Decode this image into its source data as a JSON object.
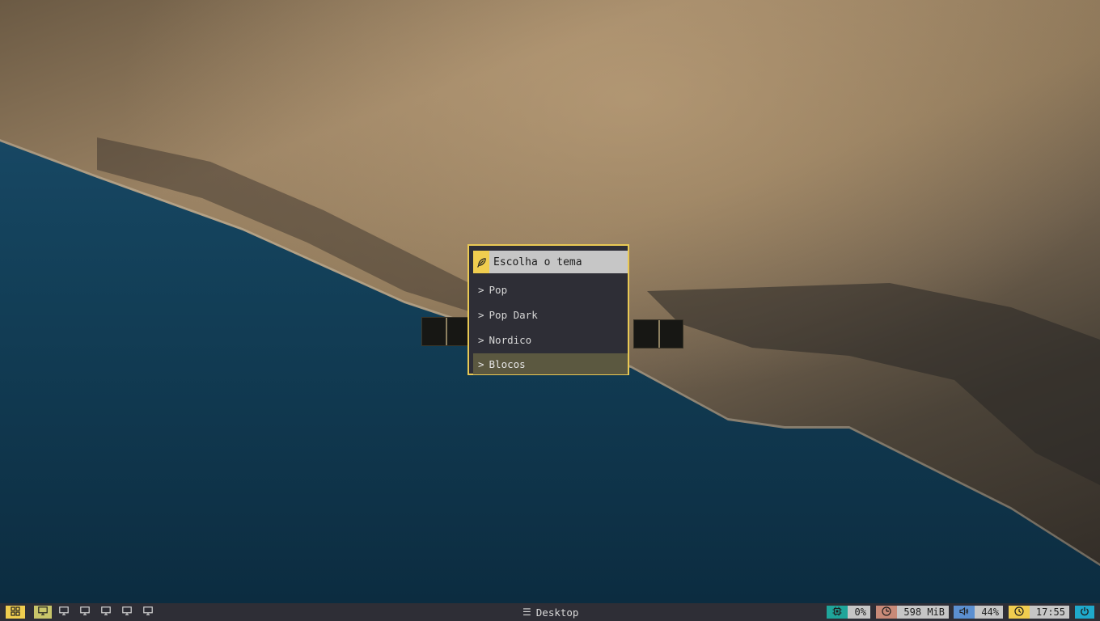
{
  "menu": {
    "prompt": "Escolha o tema",
    "prompt_icon": "feather-icon",
    "items": [
      {
        "label": "Pop",
        "selected": false
      },
      {
        "label": "Pop Dark",
        "selected": false
      },
      {
        "label": "Nordico",
        "selected": false
      },
      {
        "label": "Blocos",
        "selected": true
      }
    ],
    "arrow": ">"
  },
  "bar": {
    "launcher_icon": "grid-icon",
    "workspaces": [
      {
        "icon": "monitor-icon",
        "active": true
      },
      {
        "icon": "monitor-icon",
        "active": false
      },
      {
        "icon": "monitor-icon",
        "active": false
      },
      {
        "icon": "monitor-icon",
        "active": false
      },
      {
        "icon": "monitor-icon",
        "active": false
      },
      {
        "icon": "monitor-icon",
        "active": false
      }
    ],
    "window_title": "Desktop",
    "cpu": "0%",
    "memory": "598 MiB",
    "volume": "44%",
    "clock": "17:55",
    "colors": {
      "bar_bg": "#2e2e36",
      "accent_yellow": "#f0cd4f",
      "cpu": "#1fa59a",
      "memory": "#c88a78",
      "volume": "#5b8fd0",
      "clock": "#f0cd4f",
      "power": "#1fa9cc"
    }
  }
}
